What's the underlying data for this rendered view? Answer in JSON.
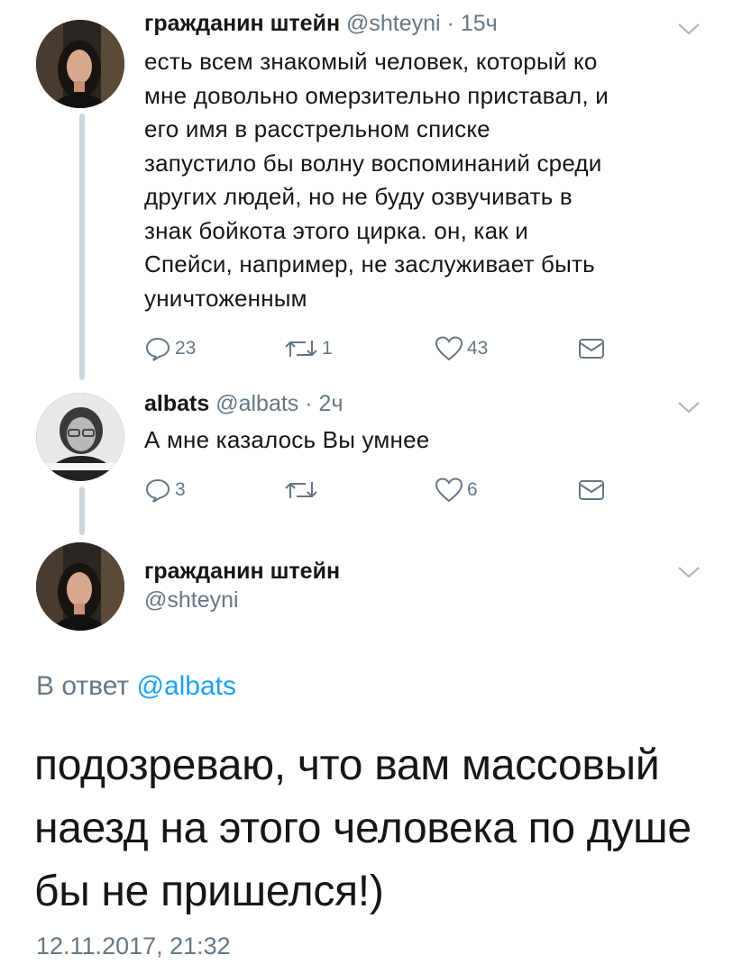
{
  "tweet1": {
    "name": "гражданин штейн",
    "handle": "@shteyni",
    "separator": "·",
    "time": "15ч",
    "text_lines": [
      "есть всем знакомый человек, который ко",
      "мне довольно омерзительно приставал, и",
      "его имя в расстрельном списке",
      "запустило бы волну воспоминаний среди",
      "других людей, но не буду озвучивать в",
      "знак бойкота этого цирка. он, как и",
      "Спейси, например, не заслуживает быть",
      "уничтоженным"
    ],
    "replies": "23",
    "retweets": "1",
    "likes": "43"
  },
  "tweet2": {
    "name": "albats",
    "handle": "@albats",
    "separator": "·",
    "time": "2ч",
    "text": "А мне казалось Вы умнее",
    "replies": "3",
    "retweets": "",
    "likes": "6"
  },
  "main": {
    "name": "гражданин штейн",
    "handle": "@shteyni",
    "reply_prefix": "В ответ",
    "reply_mention": "@albats",
    "text_lines": [
      "подозреваю, что вам массовый",
      "наезд на этого человека по душе",
      "бы не пришелся!)"
    ],
    "timestamp": "12.11.2017, 21:32"
  },
  "colors": {
    "text": "#14171a",
    "secondary": "#657786",
    "accent": "#1da1f2",
    "thread_line": "#ccd6dd"
  },
  "icons": [
    "reply-icon",
    "retweet-icon",
    "like-icon",
    "message-icon",
    "chevron-down-icon"
  ]
}
